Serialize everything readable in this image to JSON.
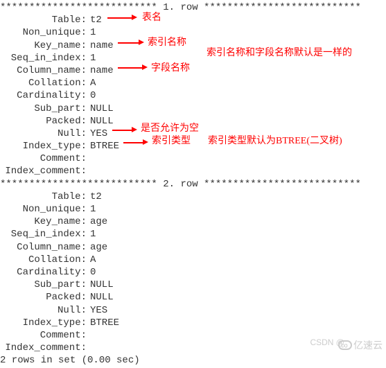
{
  "row1": {
    "header": "*************************** 1. row ***************************",
    "fields": [
      {
        "label": "Table:",
        "value": "t2"
      },
      {
        "label": "Non_unique:",
        "value": "1"
      },
      {
        "label": "Key_name:",
        "value": "name"
      },
      {
        "label": "Seq_in_index:",
        "value": "1"
      },
      {
        "label": "Column_name:",
        "value": "name"
      },
      {
        "label": "Collation:",
        "value": "A"
      },
      {
        "label": "Cardinality:",
        "value": "0"
      },
      {
        "label": "Sub_part:",
        "value": "NULL"
      },
      {
        "label": "Packed:",
        "value": "NULL"
      },
      {
        "label": "Null:",
        "value": "YES"
      },
      {
        "label": "Index_type:",
        "value": "BTREE"
      },
      {
        "label": "Comment:",
        "value": ""
      },
      {
        "label": "Index_comment:",
        "value": ""
      }
    ]
  },
  "row2": {
    "header": "*************************** 2. row ***************************",
    "fields": [
      {
        "label": "Table:",
        "value": "t2"
      },
      {
        "label": "Non_unique:",
        "value": "1"
      },
      {
        "label": "Key_name:",
        "value": "age"
      },
      {
        "label": "Seq_in_index:",
        "value": "1"
      },
      {
        "label": "Column_name:",
        "value": "age"
      },
      {
        "label": "Collation:",
        "value": "A"
      },
      {
        "label": "Cardinality:",
        "value": "0"
      },
      {
        "label": "Sub_part:",
        "value": "NULL"
      },
      {
        "label": "Packed:",
        "value": "NULL"
      },
      {
        "label": "Null:",
        "value": "YES"
      },
      {
        "label": "Index_type:",
        "value": "BTREE"
      },
      {
        "label": "Comment:",
        "value": ""
      },
      {
        "label": "Index_comment:",
        "value": ""
      }
    ]
  },
  "footer": "2 rows in set (0.00 sec)",
  "annotations": {
    "table": "表名",
    "keyname": "索引名称",
    "keyname_extra": "索引名称和字段名称默认是一样的",
    "colname": "字段名称",
    "null": "是否允许为空",
    "indextype": "索引类型",
    "indextype_extra": "索引类型默认为BTREE(二叉树)"
  },
  "watermark": {
    "csdn": "CSDN @",
    "logo": "亿速云"
  }
}
